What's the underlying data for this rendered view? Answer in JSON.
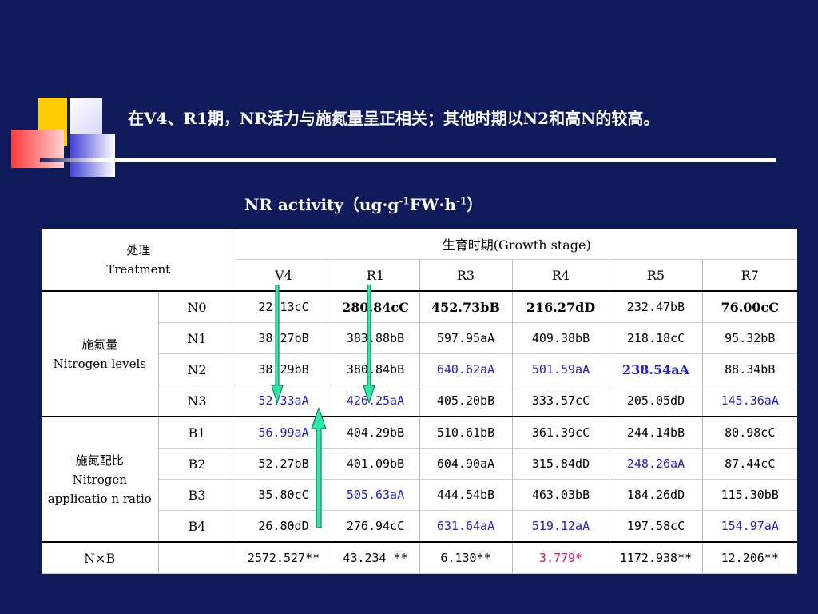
{
  "heading": "在V4、R1期，NR活力与施氮量呈正相关；其他时期以N2和高N的较高。",
  "caption": {
    "main": "NR activity（ug·g",
    "sup1": "-1",
    "mid": "FW·h",
    "sup2": "-1",
    "end": "）"
  },
  "table": {
    "treatment_header_cn": "处理",
    "treatment_header_en": "Treatment",
    "growth_stage_header": "生育时期(Growth stage)",
    "stages": [
      "V4",
      "R1",
      "R3",
      "R4",
      "R5",
      "R7"
    ],
    "group1_cn": "施氮量",
    "group1_en": "Nitrogen levels",
    "group2_cn": "施氮配比",
    "group2_en": "Nitrogen applicatio n ratio",
    "rows": [
      {
        "label": "N0",
        "values": [
          "22.13cC",
          "280.84cC",
          "452.73bB",
          "216.27dD",
          "232.47bB",
          "76.00cC"
        ]
      },
      {
        "label": "N1",
        "values": [
          "38.27bB",
          "383.88bB",
          "597.95aA",
          "409.38bB",
          "218.18cC",
          "95.32bB"
        ]
      },
      {
        "label": "N2",
        "values": [
          "38.29bB",
          "380.84bB",
          "640.62aA",
          "501.59aA",
          "238.54aA",
          "88.34bB"
        ]
      },
      {
        "label": "N3",
        "values": [
          "52.33aA",
          "426.25aA",
          "405.20bB",
          "333.57cC",
          "205.05dD",
          "145.36aA"
        ]
      },
      {
        "label": "B1",
        "values": [
          "56.99aA",
          "404.29bB",
          "510.61bB",
          "361.39cC",
          "244.14bB",
          "80.98cC"
        ]
      },
      {
        "label": "B2",
        "values": [
          "52.27bB",
          "401.09bB",
          "604.90aA",
          "315.84dD",
          "248.26aA",
          "87.44cC"
        ]
      },
      {
        "label": "B3",
        "values": [
          "35.80cC",
          "505.63aA",
          "444.54bB",
          "463.03bB",
          "184.26dD",
          "115.30bB"
        ]
      },
      {
        "label": "B4",
        "values": [
          "26.80dD",
          "276.94cC",
          "631.64aA",
          "519.12aA",
          "197.58cC",
          "154.97aA"
        ]
      }
    ],
    "nxb_label": "N×B",
    "nxb_values": [
      "2572.527**",
      "43.234 **",
      "6.130**",
      "3.779*",
      "1172.938**",
      "12.206**"
    ]
  },
  "colors": {
    "background": "#0e1a5a",
    "highlight_blue": "#2020d0",
    "highlight_red": "#e0105a",
    "arrow_fill": "#2ee8a8"
  }
}
